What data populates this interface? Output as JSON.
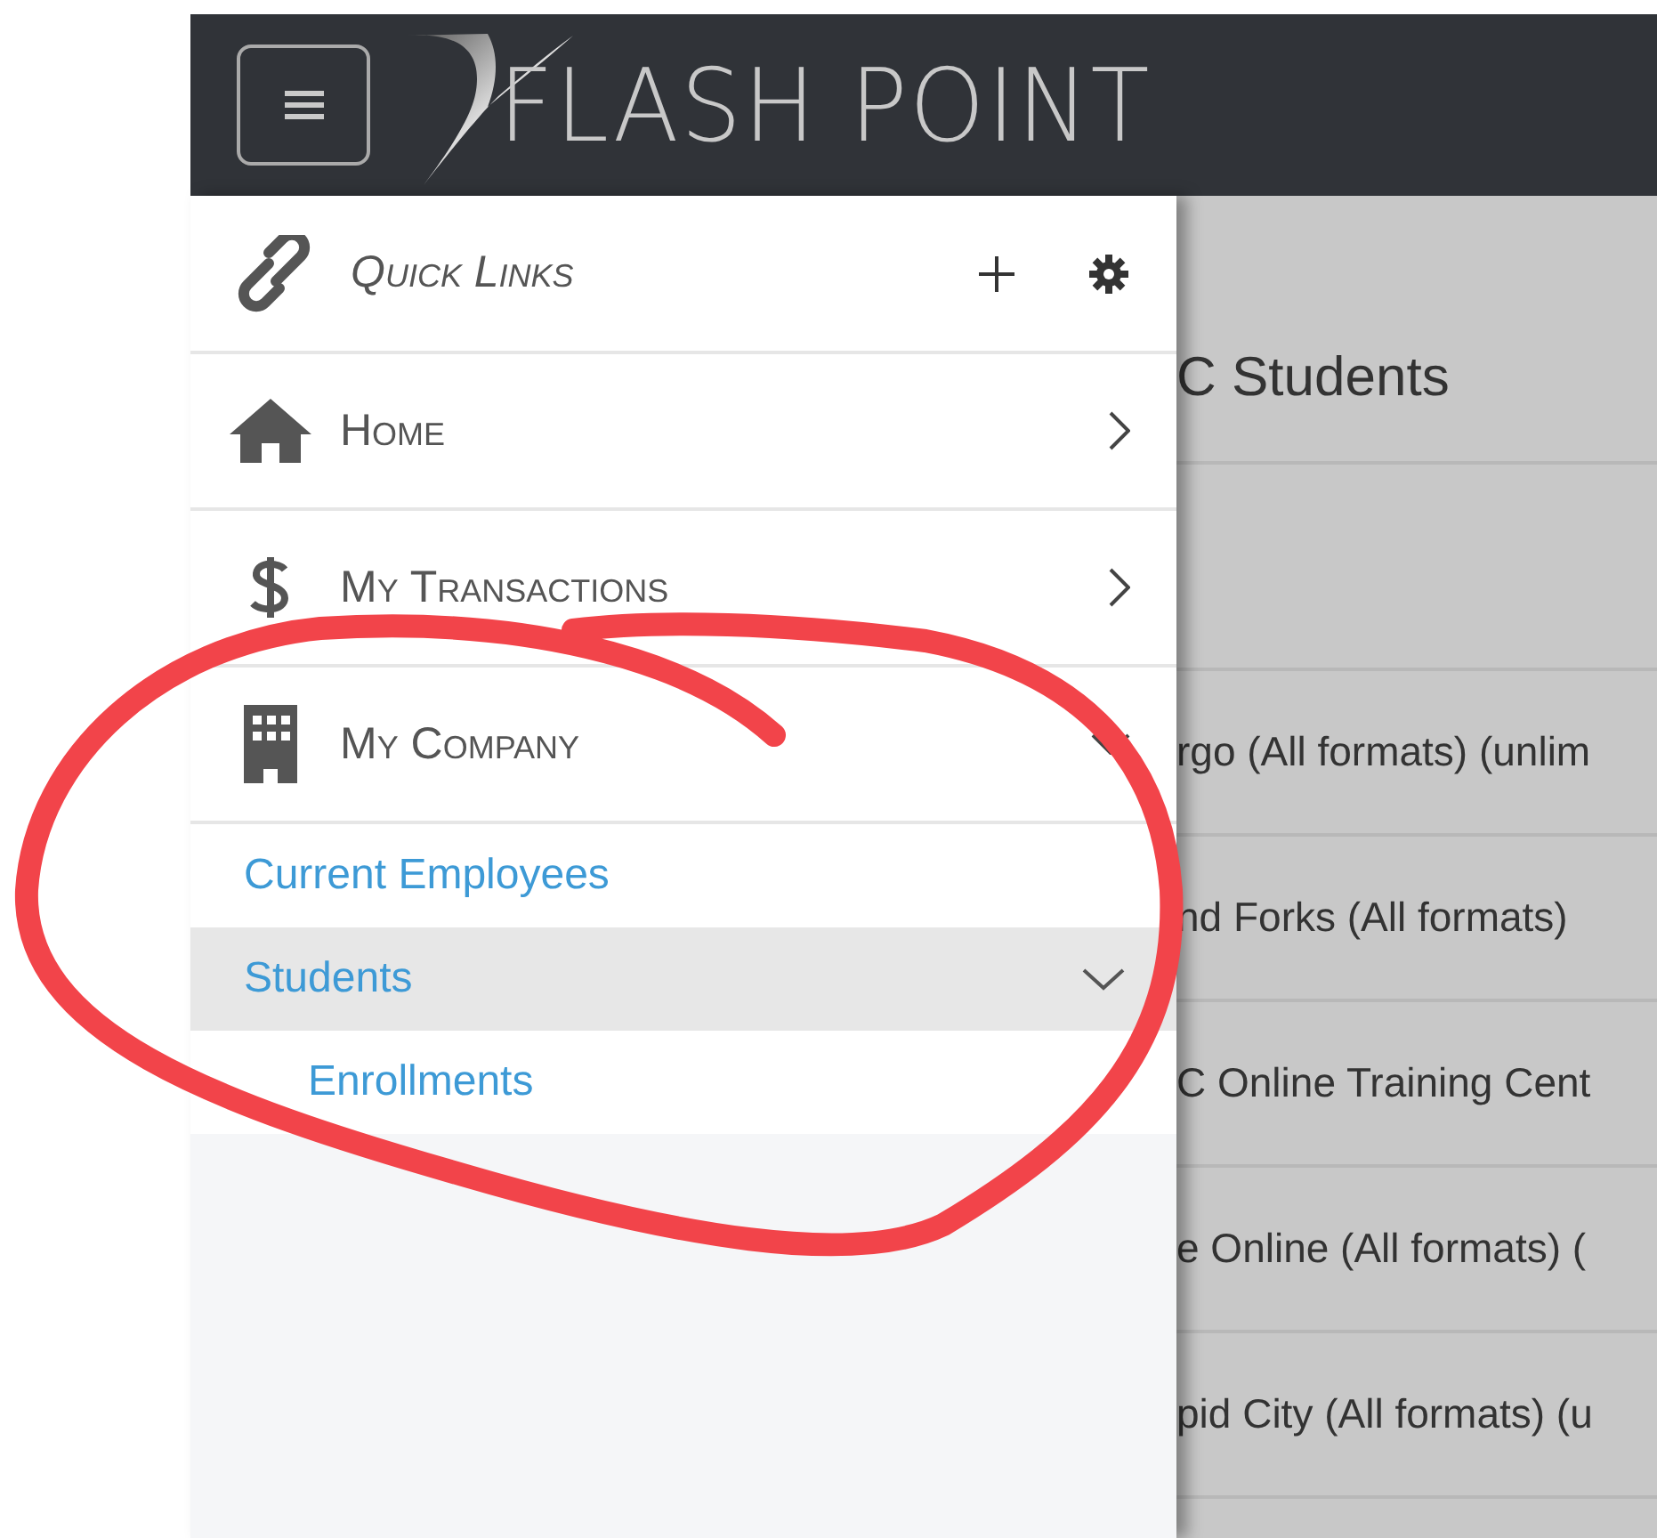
{
  "header": {
    "logo_text": "FLASH POINT"
  },
  "sidebar": {
    "quick_links": {
      "title": "Quick Links"
    },
    "items": [
      {
        "kind": "home",
        "label": "Home",
        "expanded": false
      },
      {
        "kind": "money",
        "label": "My Transactions",
        "expanded": false
      },
      {
        "kind": "company",
        "label": "My Company",
        "expanded": true,
        "children": [
          {
            "label": "Current Employees",
            "selected": false,
            "expanded": false
          },
          {
            "label": "Students",
            "selected": true,
            "expanded": true,
            "children": [
              {
                "label": "Enrollments",
                "selected": false
              }
            ]
          }
        ]
      }
    ]
  },
  "content": {
    "title": "C Students",
    "rows": [
      "rgo (All formats) (unlim",
      "nd Forks (All formats)",
      "C Online Training Cent",
      "e Online (All formats) (",
      "pid City (All formats) (u"
    ]
  },
  "annotations": [
    {
      "kind": "freehand-circle",
      "color": "#f2444a"
    }
  ]
}
